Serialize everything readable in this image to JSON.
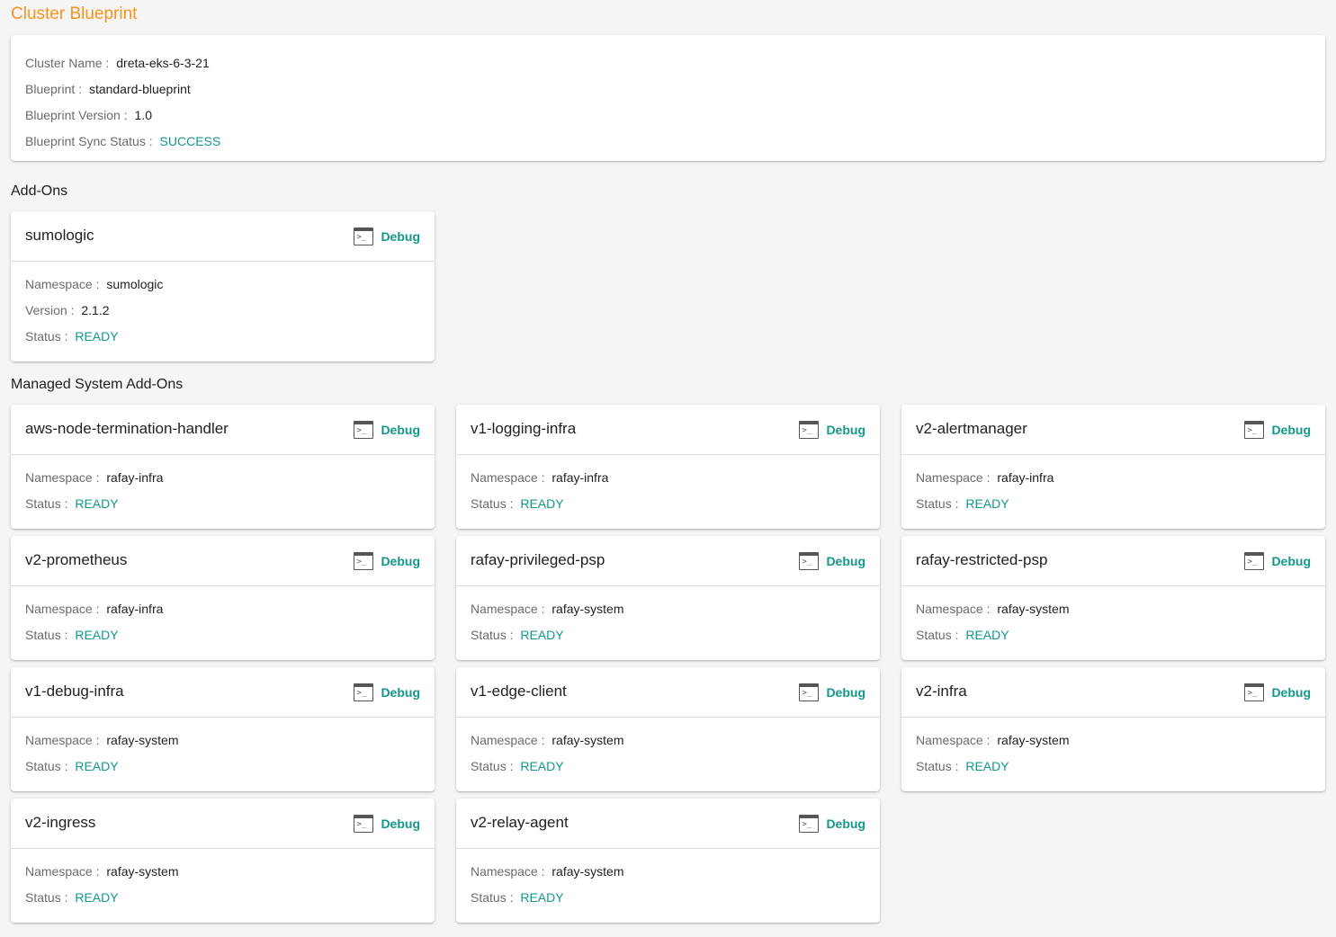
{
  "page": {
    "title": "Cluster Blueprint"
  },
  "summary": {
    "cluster_name_label": "Cluster Name :",
    "cluster_name": "dreta-eks-6-3-21",
    "blueprint_label": "Blueprint :",
    "blueprint": "standard-blueprint",
    "version_label": "Blueprint Version :",
    "version": "1.0",
    "sync_label": "Blueprint Sync Status :",
    "sync_status": "SUCCESS"
  },
  "labels": {
    "namespace": "Namespace :",
    "version": "Version :",
    "status": "Status :",
    "debug": "Debug",
    "terminal_glyph": ">_"
  },
  "addons": {
    "title": "Add-Ons",
    "items": [
      {
        "name": "sumologic",
        "namespace": "sumologic",
        "version": "2.1.2",
        "status": "READY"
      }
    ]
  },
  "managed": {
    "title": "Managed System Add-Ons",
    "items": [
      {
        "name": "aws-node-termination-handler",
        "namespace": "rafay-infra",
        "status": "READY"
      },
      {
        "name": "v1-logging-infra",
        "namespace": "rafay-infra",
        "status": "READY"
      },
      {
        "name": "v2-alertmanager",
        "namespace": "rafay-infra",
        "status": "READY"
      },
      {
        "name": "v2-prometheus",
        "namespace": "rafay-infra",
        "status": "READY"
      },
      {
        "name": "rafay-privileged-psp",
        "namespace": "rafay-system",
        "status": "READY"
      },
      {
        "name": "rafay-restricted-psp",
        "namespace": "rafay-system",
        "status": "READY"
      },
      {
        "name": "v1-debug-infra",
        "namespace": "rafay-system",
        "status": "READY"
      },
      {
        "name": "v1-edge-client",
        "namespace": "rafay-system",
        "status": "READY"
      },
      {
        "name": "v2-infra",
        "namespace": "rafay-system",
        "status": "READY"
      },
      {
        "name": "v2-ingress",
        "namespace": "rafay-system",
        "status": "READY"
      },
      {
        "name": "v2-relay-agent",
        "namespace": "rafay-system",
        "status": "READY"
      }
    ]
  },
  "colors": {
    "accent": "#f7941d",
    "status_ok": "#12988a"
  }
}
